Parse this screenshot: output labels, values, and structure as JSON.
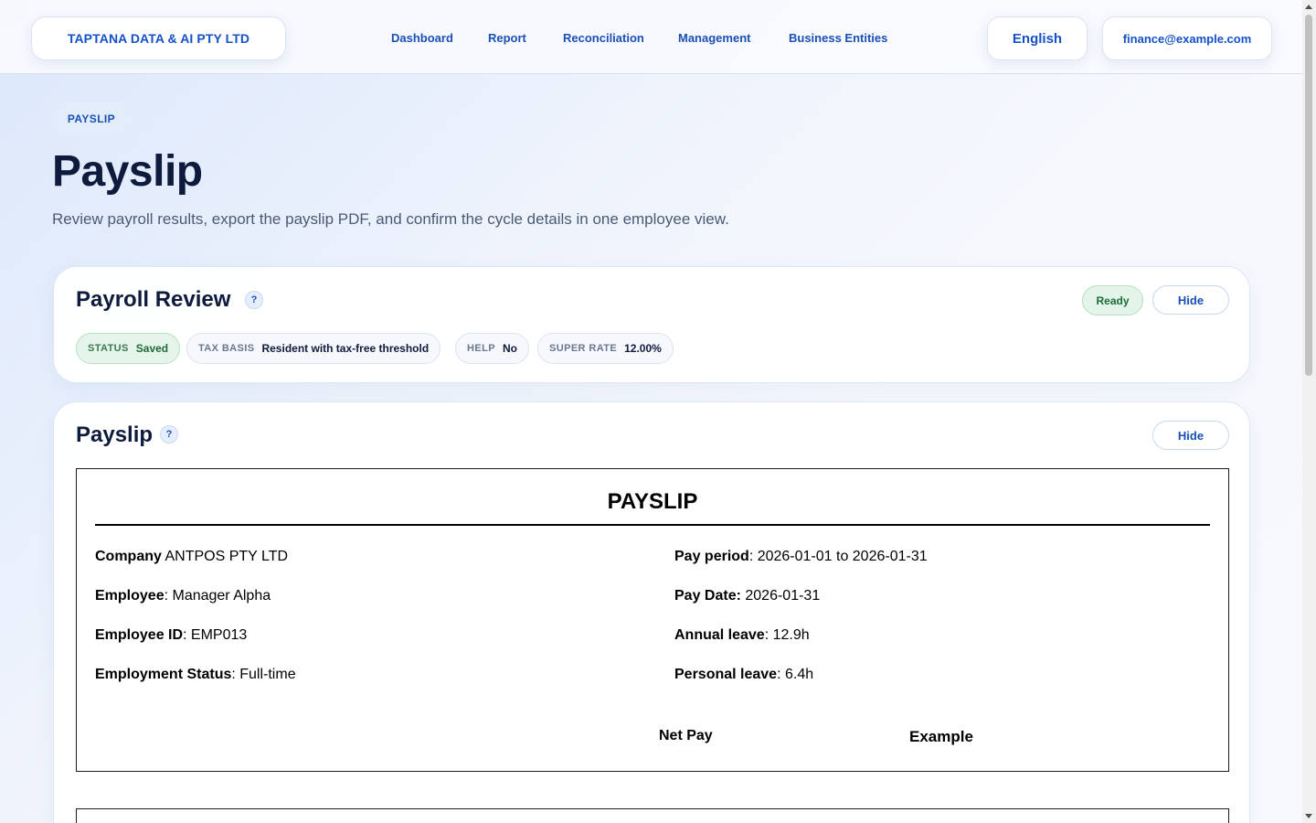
{
  "header": {
    "brand": "TAPTANA DATA & AI PTY LTD",
    "nav": [
      "Dashboard",
      "Report",
      "Reconciliation",
      "Management",
      "Business Entities"
    ],
    "language": "English",
    "account": "finance@example.com"
  },
  "page": {
    "tag": "PAYSLIP",
    "title": "Payslip",
    "subtitle": "Review payroll results, export the payslip PDF, and confirm the cycle details in one employee view."
  },
  "review": {
    "title": "Payroll Review",
    "help": "?",
    "ready": "Ready",
    "hide": "Hide",
    "chips": [
      {
        "key": "STATUS",
        "value": "Saved"
      },
      {
        "key": "TAX BASIS",
        "value": "Resident with tax-free threshold"
      },
      {
        "key": "HELP",
        "value": "No"
      },
      {
        "key": "SUPER RATE",
        "value": "12.00%"
      }
    ]
  },
  "payslip_card": {
    "title": "Payslip",
    "help": "?",
    "hide": "Hide"
  },
  "document": {
    "title": "PAYSLIP",
    "company_label": "Company",
    "company_value": " ANTPOS PTY LTD",
    "employee_label": "Employee",
    "employee_value": ": Manager Alpha",
    "employee_id_label": "Employee ID",
    "employee_id_value": ": EMP013",
    "employment_status_label": "Employment Status",
    "employment_status_value": ": Full-time",
    "pay_period_label": "Pay period",
    "pay_period_value": ": 2026-01-01 to 2026-01-31",
    "pay_date_label": "Pay Date:",
    "pay_date_value": " 2026-01-31",
    "annual_leave_label": "Annual leave",
    "annual_leave_value": ": 12.9h",
    "personal_leave_label": "Personal leave",
    "personal_leave_value": ": 6.4h",
    "net_pay_label": "Net Pay",
    "net_pay_value": "Example"
  }
}
